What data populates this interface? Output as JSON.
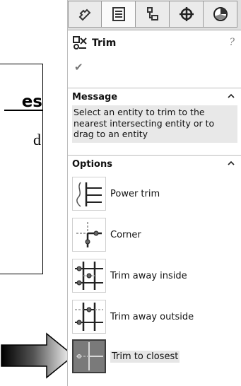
{
  "page_fragment": {
    "heading": "es",
    "text": "d"
  },
  "panel": {
    "tabs": [
      {
        "name": "featuremanager-icon",
        "active": false
      },
      {
        "name": "propertymanager-icon",
        "active": true
      },
      {
        "name": "configurationmanager-icon",
        "active": false
      },
      {
        "name": "dimxpertmanager-icon",
        "active": false
      },
      {
        "name": "displaymanager-icon",
        "active": false
      }
    ],
    "title": "Trim",
    "help": "?",
    "ok": "✔",
    "message": {
      "header": "Message",
      "text": "Select an entity to trim to the nearest intersecting entity or to drag to an entity"
    },
    "options": {
      "header": "Options",
      "items": [
        {
          "label": "Power trim",
          "icon": "power-trim-icon"
        },
        {
          "label": "Corner",
          "icon": "corner-icon"
        },
        {
          "label": "Trim away inside",
          "icon": "trim-away-inside-icon"
        },
        {
          "label": "Trim away outside",
          "icon": "trim-away-outside-icon"
        },
        {
          "label": "Trim to closest",
          "icon": "trim-to-closest-icon",
          "selected": true
        }
      ]
    }
  },
  "colors": {
    "selected_bg": "#7a7a7a",
    "message_bg": "#e8e8e8"
  }
}
